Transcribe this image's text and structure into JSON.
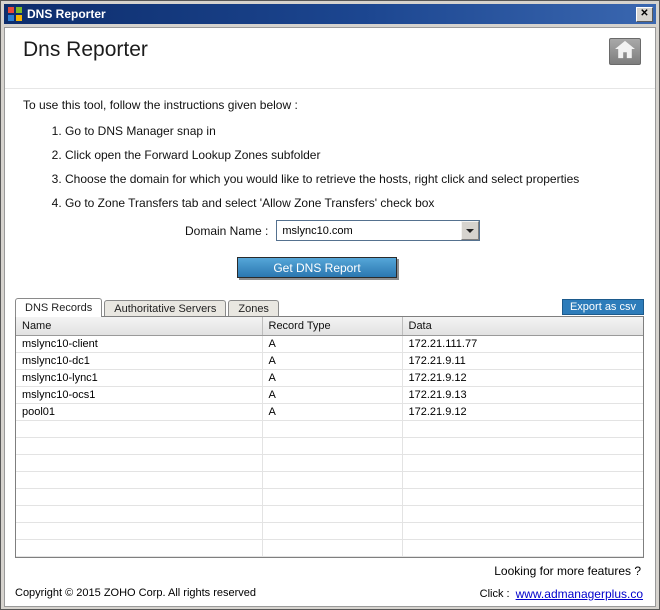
{
  "window": {
    "title": "DNS Reporter"
  },
  "icons": {
    "close": "✕"
  },
  "header": {
    "title": "Dns Reporter"
  },
  "instructions": {
    "intro": "To use this tool, follow the instructions given below :",
    "steps": [
      "Go to DNS Manager snap in",
      "Click open the Forward Lookup Zones subfolder",
      "Choose the domain for which you would like to retrieve the hosts, right click and select properties",
      "Go to Zone Transfers tab and select 'Allow Zone Transfers' check box"
    ]
  },
  "domain": {
    "label": "Domain Name :",
    "value": "mslync10.com"
  },
  "actions": {
    "get_report": "Get DNS Report",
    "export_csv": "Export as csv"
  },
  "tabs": [
    {
      "label": "DNS Records",
      "active": true
    },
    {
      "label": "Authoritative Servers",
      "active": false
    },
    {
      "label": "Zones",
      "active": false
    }
  ],
  "table": {
    "headers": [
      "Name",
      "Record Type",
      "Data"
    ],
    "rows": [
      [
        "mslync10-client",
        "A",
        "172.21.111.77"
      ],
      [
        "mslync10-dc1",
        "A",
        "172.21.9.11"
      ],
      [
        "mslync10-lync1",
        "A",
        "172.21.9.12"
      ],
      [
        "mslync10-ocs1",
        "A",
        "172.21.9.13"
      ],
      [
        "pool01",
        "A",
        "172.21.9.12"
      ]
    ],
    "empty_row_slots": 8
  },
  "footer": {
    "features_text": "Looking for more features ?",
    "copyright": "Copyright © 2015 ZOHO Corp. All rights reserved",
    "click_label": "Click :",
    "link": "www.admanagerplus.co"
  }
}
